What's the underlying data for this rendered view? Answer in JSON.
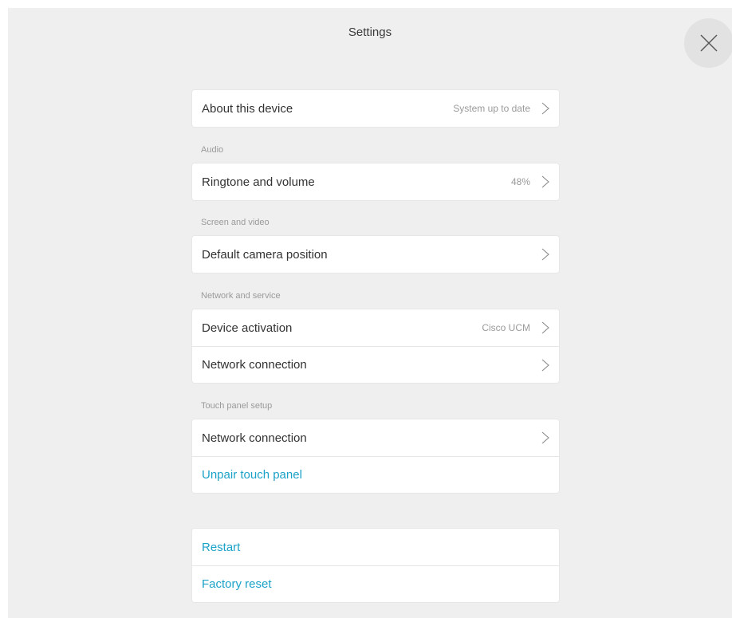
{
  "header": {
    "title": "Settings",
    "close_icon": "close-icon"
  },
  "about": {
    "label": "About this device",
    "value": "System up to date"
  },
  "audio": {
    "section": "Audio",
    "ringtone_label": "Ringtone and volume",
    "ringtone_value": "48%"
  },
  "screen_video": {
    "section": "Screen and video",
    "camera_label": "Default camera position"
  },
  "network_service": {
    "section": "Network and service",
    "activation_label": "Device activation",
    "activation_value": "Cisco UCM",
    "network_label": "Network connection"
  },
  "touch_panel": {
    "section": "Touch panel setup",
    "network_label": "Network connection",
    "unpair_label": "Unpair touch panel"
  },
  "system": {
    "restart_label": "Restart",
    "factory_reset_label": "Factory reset"
  },
  "colors": {
    "accent": "#1ba2c8",
    "background": "#efefef",
    "card": "#ffffff"
  }
}
